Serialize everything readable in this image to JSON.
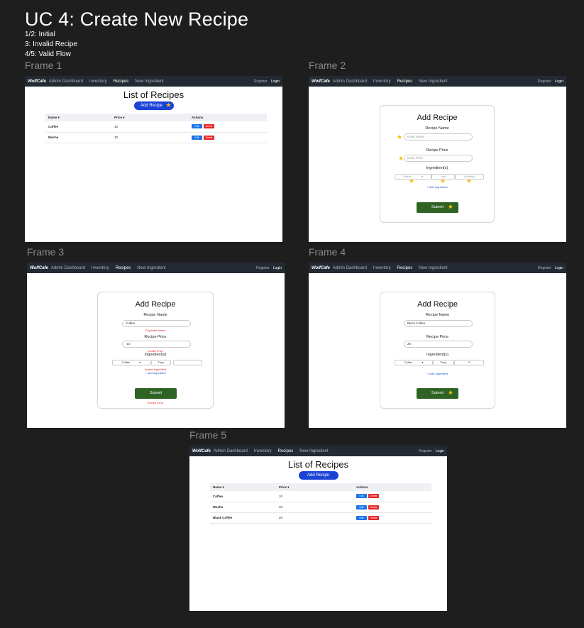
{
  "title": "UC 4: Create New Recipe",
  "notes": [
    "1/2: Initial",
    "3: Invalid Recipe",
    "4/5: Valid Flow"
  ],
  "frame_labels": [
    "Frame 1",
    "Frame 2",
    "Frame 3",
    "Frame 4",
    "Frame 5"
  ],
  "colors": {
    "page_bg": "#1e1e1e",
    "navbar_bg": "#232a33",
    "add_button": "#1b44d6",
    "submit_button": "#2e6324",
    "edit_button": "#1a73e8",
    "delete_button": "#e32626",
    "star": "#f4c20d",
    "error_text": "#e32626",
    "link": "#1a56c8"
  },
  "icons": {
    "annotation_marker": "star-icon",
    "sort": "sort-icon"
  },
  "nav": {
    "brand": "WolfCafe",
    "items": [
      "Admin Dashboard",
      "Inventory",
      "Recipes",
      "New Ingredient"
    ],
    "active": "Recipes",
    "register": "Register",
    "login": "Login"
  },
  "list": {
    "title": "List of Recipes",
    "add_button": "Add Recipe",
    "columns": [
      "Name ▾",
      "Price ▾",
      "Actions"
    ],
    "edit": "Edit",
    "delete": "Delete",
    "rows_initial": [
      {
        "name": "Coffee",
        "price": "10"
      },
      {
        "name": "Mocha",
        "price": "10"
      }
    ],
    "rows_final": [
      {
        "name": "Coffee",
        "price": "10"
      },
      {
        "name": "Mocha",
        "price": "10"
      },
      {
        "name": "Black Coffee",
        "price": "20"
      }
    ]
  },
  "form": {
    "title": "Add Recipe",
    "name_label": "Recipe Name",
    "price_label": "Recipe Price",
    "ingredients_label": "Ingredient(s)",
    "name_placeholder": "Enter Name",
    "price_placeholder": "Enter Price",
    "select_placeholder": "Select",
    "unit_placeholder": "Unit",
    "quantity_placeholder": "Quantity",
    "add_ingredient": "+ Add Ingredient",
    "submit": "Submit",
    "caret": "▾"
  },
  "frame3": {
    "name_value": "Coffee",
    "name_error": "Duplicate Name",
    "price_value": "-10",
    "price_error": "Invalid Price",
    "ingredient_value": "Coffee",
    "unit_value": "Tbsp",
    "ingredient_error": "Invalid Ingredient",
    "recipe_error": "Recipe Error"
  },
  "frame4": {
    "name_value": "Black Coffee",
    "price_value": "20",
    "ingredient_value": "Coffee",
    "unit_value": "Tbsp.",
    "quantity_value": "3"
  }
}
